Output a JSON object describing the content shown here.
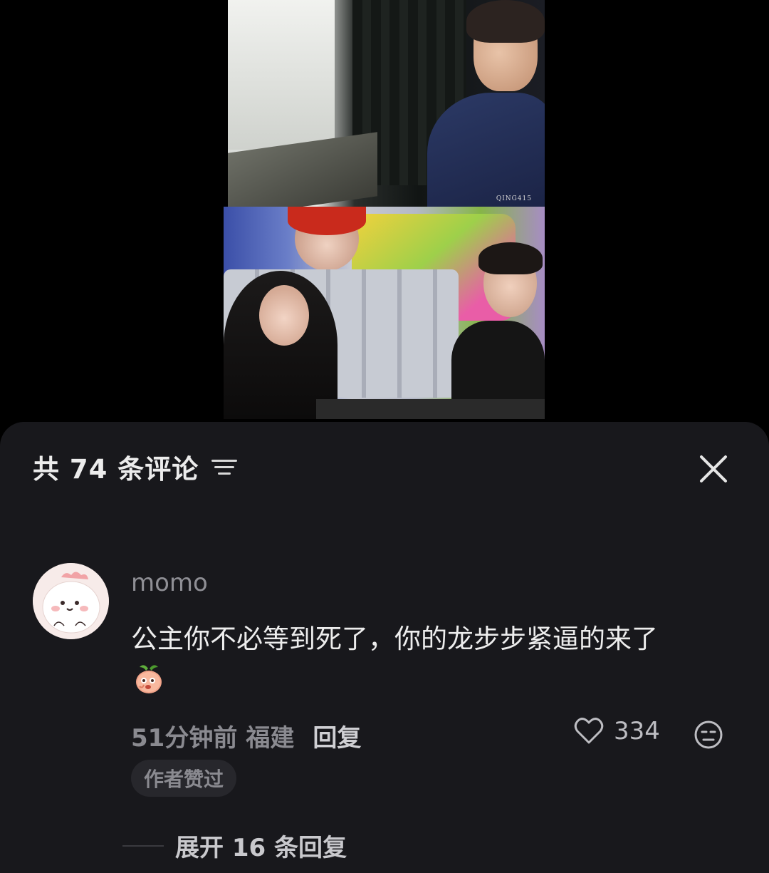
{
  "video": {
    "watermark": "QING415"
  },
  "comments_sheet": {
    "header": {
      "count_label": "共 74 条评论",
      "sort_icon": "sort-lines-icon",
      "close_icon": "close-icon"
    },
    "comment": {
      "username": "momo",
      "text": "公主你不必等到死了，你的龙步步紧逼的来了",
      "emoji": "peach-emoji",
      "time": "51分钟前",
      "location": "福建",
      "reply_label": "回复",
      "like_count": "334",
      "author_badge": "作者赞过",
      "expand_label": "展开 16 条回复"
    },
    "colors": {
      "sheet_bg": "#18181c",
      "text_primary": "#ededed",
      "text_secondary": "#8a8a90"
    }
  }
}
